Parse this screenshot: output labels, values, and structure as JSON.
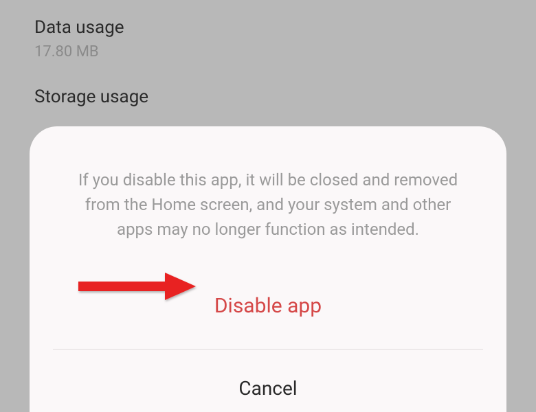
{
  "settings": {
    "dataUsage": {
      "label": "Data usage",
      "value": "17.80 MB"
    },
    "storageUsage": {
      "label": "Storage usage"
    }
  },
  "modal": {
    "message": "If you disable this app, it will be closed and removed from the Home screen, and your system and other apps may no longer function as intended.",
    "disableLabel": "Disable app",
    "cancelLabel": "Cancel"
  }
}
